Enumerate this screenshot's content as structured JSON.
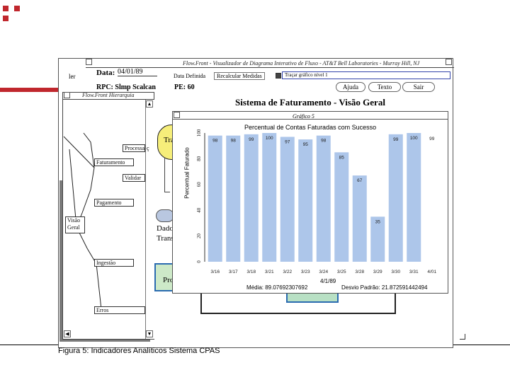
{
  "main_window": {
    "title": "Flow.Front - Visualizador de Diagrama Interativo de Fluxo - AT&T Bell Laboratories - Murray Hill, NJ",
    "date_label": "Data:",
    "date_value": "04/01/89",
    "data_definida_button": "Data Definida",
    "recalcular_button": "Recalcular Medidas",
    "tracar_label": "Traçar gráfico nível 1",
    "rpc_label": "RPC: Slmp Scalcan",
    "pe_label": "PE: 60",
    "ajuda_button": "Ajuda",
    "texto_button": "Texto",
    "sair_button": "Sair",
    "page_title": "Sistema de Faturamento - Visão Geral",
    "behind_tra": "Tra",
    "behind_dado": "Dado",
    "behind_trans": "Trans",
    "behind_pro": "Pro",
    "left_stub": "ler"
  },
  "hierarchy_window": {
    "title": "Flow.Front Hierarquia",
    "nodes": [
      "Processamento",
      "Faturamento",
      "Validar",
      "Pagamento",
      "Visão Geral",
      "Ingestão",
      "Erros"
    ],
    "partial_label": "ç"
  },
  "chart_window": {
    "title": "Gráfico 5",
    "footer_date": "4/1/89",
    "media": "Média: 89.07692307692",
    "desvio": "Desvio Padrão: 21.872591442494"
  },
  "chart_data": {
    "type": "bar",
    "title": "Percentual de Contas Faturadas com Sucesso",
    "ylabel": "Percentual Faturado",
    "xlabel": "",
    "categories": [
      "3/16",
      "3/17",
      "3/18",
      "3/21",
      "3/22",
      "3/23",
      "3/24",
      "3/25",
      "3/28",
      "3/29",
      "3/30",
      "3/31",
      "4/01"
    ],
    "values": [
      98,
      98,
      99,
      100,
      97,
      95,
      98,
      85,
      67,
      35,
      99,
      100,
      99
    ],
    "ylim": [
      0,
      100
    ],
    "yticks": [
      "0",
      "20",
      "40",
      "60",
      "80",
      "100"
    ],
    "grid": false,
    "colors": {
      "bar": "#adc6ea"
    }
  },
  "caption": "Figura 5:  Indicadores Analíticos Sistema CPAS",
  "colors": {
    "accent_red": "#c0272d"
  }
}
